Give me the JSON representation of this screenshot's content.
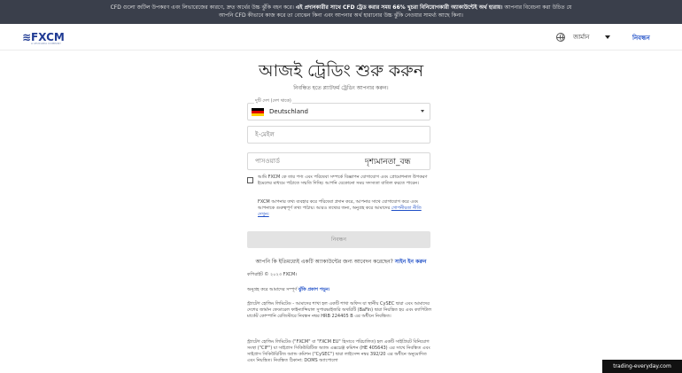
{
  "banner": {
    "text_before": "CFD গুলো জটিল উপকরণ এবং লিভারেজের কারণে, দ্রুত অর্থের উচ্চ ঝুঁকি বহন করে।",
    "text_bold": "এই প্রদানকারীর সাথে CFD ট্রেড করার সময় 66% খুচরা বিনিয়োগকারী অ্যাকাউন্টেই অর্থ হারায়।",
    "text_after": "আপনার বিবেচনা করা উচিত যে আপনি CFD কীভাবে কাজ করে তা বোঝেন কিনা এবং আপনার অর্থ হারানোর উচ্চ ঝুঁকি নেওয়ার সামর্থ্য আছে কিনা।"
  },
  "header": {
    "logo_text": "≋FXCM",
    "logo_subtext": "A LEUCADIA COMPANY",
    "language": "জার্মান",
    "register_link": "নিবন্ধন"
  },
  "form": {
    "title": "আজই ট্রেডিং শুরু করুন",
    "subtitle": "নিবন্ধিত হতে প্ল্যাটফর্ম ট্রেডিং আপনার করুন।",
    "country_label": "দুটি দেশ (দেশ থাকে)",
    "country_value": "Deutschland",
    "email_placeholder": "ই-মেইল",
    "password_placeholder": "পাসওয়ার্ড",
    "password_toggle": "দৃশ্যমানতা_বন্ধ",
    "consent_text": "আমি FXCM কে তার পণ্য এবং পরিষেবা সম্পর্কে বিজ্ঞাপন যোগাযোগ এবং প্রোমোশনাল উপকরণ ইমেলের মাধ্যমে পাঠাতে সম্মতি দিচ্ছি। আপনি যেকোনো সময় সদস্যতা বাতিল করতে পারেন।",
    "privacy_text": "FXCM আপনার তথ্য ব্যবহার করে পরিষেবা প্রদান করে, আপনার সাথে যোগাযোগ করে এবং আপনাকে গুরুত্বপূর্ণ তথ্য পাঠায়। আরও তথ্যের জন্য, অনুগ্রহ করে আমাদের",
    "privacy_link": "গোপনীয়তা নীতি দেখুন।",
    "submit_label": "নিবন্ধন",
    "broker_question": "আপনি কি ইতিমধ্যেই একটি অ্যাকাউন্টের জন্য আবেদন করেছেন?",
    "broker_link": "সাইন ইন করুন"
  },
  "footer": {
    "copyright": "কপিরাইট © ২০২৩ FXCM।",
    "risk_prefix": "অনুগ্রহ করে আমাদের সম্পূর্ণ",
    "risk_link": "ঝুঁকি প্রকাশ পড়ুন।",
    "legal_1": "স্ট্র্যাটেগ হোল্ডিং লিমিটেড - আমাদের শাখা হল একটি শাখা অফিস যা স্থানীয় CySEC দ্বারা এবং আমাদের দেশের জার্মান ফেডারেল ফাইন্যান্সিয়াল সুপারভাইজরি অথরিটি (BaFin) দ্বারা নিয়ন্ত্রিত হয় এবং ক্যাপিটাল মার্কেট কোম্পানি রেজিস্টারে নিবন্ধন নম্বর HRB 224405 B এর অধীনে নিবন্ধিত।",
    "legal_2": "স্ট্র্যাটেগ হোল্ডিং লিমিটেড (\"FXCM\" বা \"FXCM EU\" হিসাবে পরিচালিত) হল একটি সাইপ্রিয়ট বিনিয়োগ সংস্থা (\"CIF\") যা সাইপ্রাস সিকিউরিটিজ অ্যান্ড এক্সচেঞ্জ কমিশন (HE 405643) এর সাথে নিবন্ধিত এবং সাইপ্রাস সিকিউরিটিজ অ্যান্ড কমিশন (\"CySEC\") দ্বারা লাইসেন্স নম্বর 392/20 এর অধীনে অনুমোদিত এবং নিয়ন্ত্রিত। নিবন্ধিত ঠিকানা: DOMS অ্যাপোলো"
  },
  "watermark": "trading-everyday.com",
  "colors": {
    "banner_bg": "#3a3f4b",
    "accent": "#1f4fc7",
    "button_disabled": "#e3e3e3"
  }
}
